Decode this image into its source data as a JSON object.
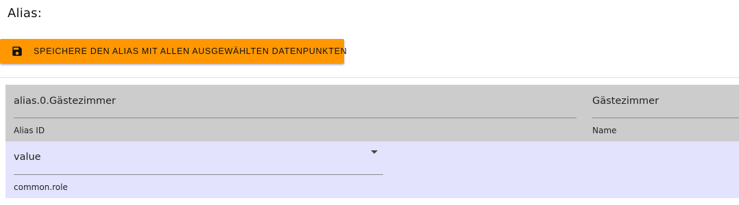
{
  "header": {
    "title": "Alias:"
  },
  "toolbar": {
    "save_label": "SPEICHERE DEN ALIAS MIT ALLEN AUSGEWÄHLTEN DATENPUNKTEN",
    "save_icon": "save-icon",
    "accent_color": "#ff9800"
  },
  "alias_row": {
    "background": "#cccccc",
    "alias_id": {
      "value": "alias.0.Gästezimmer",
      "helper": "Alias ID"
    },
    "name": {
      "value": "Gästezimmer",
      "helper": "Name"
    }
  },
  "role_row": {
    "background": "#e3e3fd",
    "role_select": {
      "value": "value",
      "helper": "common.role",
      "icon": "dropdown-arrow-icon"
    }
  }
}
